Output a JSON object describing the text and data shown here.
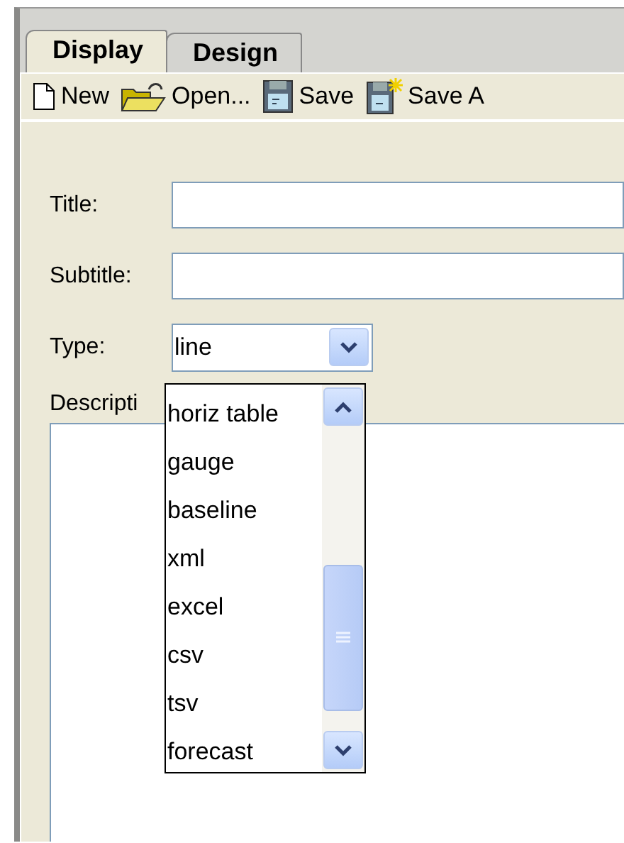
{
  "tabs": [
    {
      "label": "Display",
      "selected": true
    },
    {
      "label": "Design",
      "selected": false
    }
  ],
  "toolbar": [
    {
      "kind": "new",
      "label": "New"
    },
    {
      "kind": "open",
      "label": "Open..."
    },
    {
      "kind": "save",
      "label": "Save"
    },
    {
      "kind": "saveas",
      "label": "Save A"
    }
  ],
  "fields": [
    {
      "kind": "text",
      "label": "Title:"
    },
    {
      "kind": "text",
      "label": "Subtitle:"
    },
    {
      "kind": "combo",
      "label": "Type:",
      "value": "line",
      "expanded": true
    }
  ],
  "description": {
    "label": "Descripti"
  },
  "type_options": [
    "horiz table",
    "gauge",
    "baseline",
    "xml",
    "excel",
    "csv",
    "tsv",
    "forecast"
  ]
}
